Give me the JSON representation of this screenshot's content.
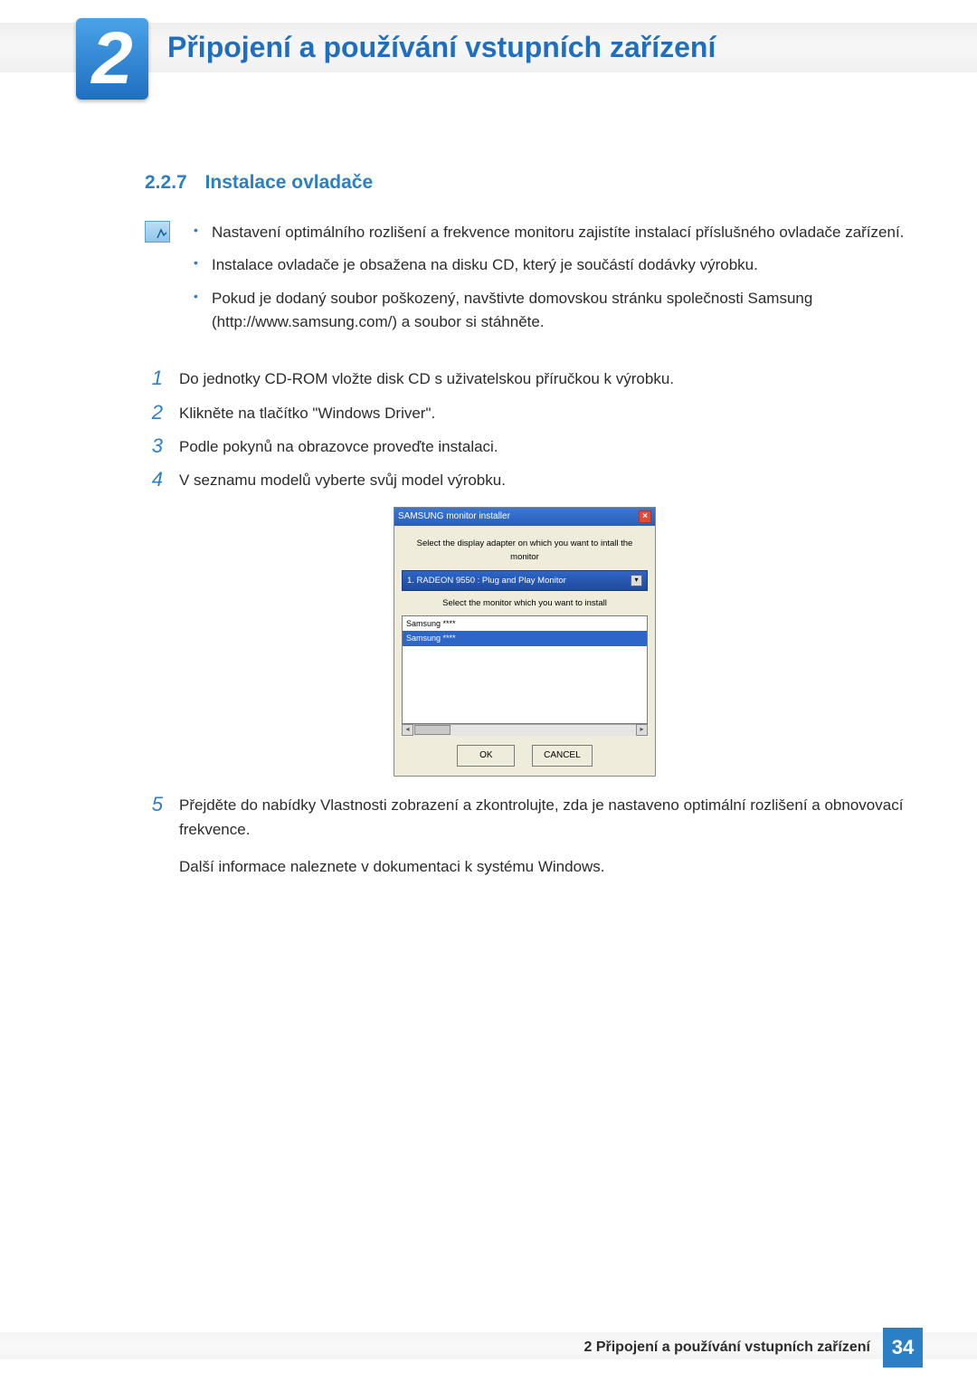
{
  "header": {
    "chapter_number": "2",
    "chapter_title": "Připojení a používání vstupních zařízení"
  },
  "section": {
    "number": "2.2.7",
    "title": "Instalace ovladače"
  },
  "notes": [
    "Nastavení optimálního rozlišení a frekvence monitoru zajistíte instalací příslušného ovladače zařízení.",
    "Instalace ovladače je obsažena na disku CD, který je součástí dodávky výrobku.",
    "Pokud je dodaný soubor poškozený, navštivte domovskou stránku společnosti Samsung (http://www.samsung.com/) a soubor si stáhněte."
  ],
  "steps": [
    {
      "n": "1",
      "text": "Do jednotky CD-ROM vložte disk CD s uživatelskou příručkou k výrobku."
    },
    {
      "n": "2",
      "text": "Klikněte na tlačítko \"Windows Driver\"."
    },
    {
      "n": "3",
      "text": "Podle pokynů na obrazovce proveďte instalaci."
    },
    {
      "n": "4",
      "text": "V seznamu modelů vyberte svůj model výrobku."
    },
    {
      "n": "5",
      "text": "Přejděte do nabídky Vlastnosti zobrazení a zkontrolujte, zda je nastaveno optimální rozlišení a obnovovací frekvence.",
      "extra": "Další informace naleznete v dokumentaci k systému Windows."
    }
  ],
  "installer": {
    "title": "SAMSUNG monitor installer",
    "label_adapter": "Select the display adapter on which you want to intall the monitor",
    "selected_adapter": "1. RADEON 9550 : Plug and Play Monitor",
    "label_monitor": "Select the monitor which you want to install",
    "list": [
      "Samsung ****",
      "Samsung ****"
    ],
    "ok": "OK",
    "cancel": "CANCEL"
  },
  "footer": {
    "text": "2 Připojení a používání vstupních zařízení",
    "page": "34"
  }
}
